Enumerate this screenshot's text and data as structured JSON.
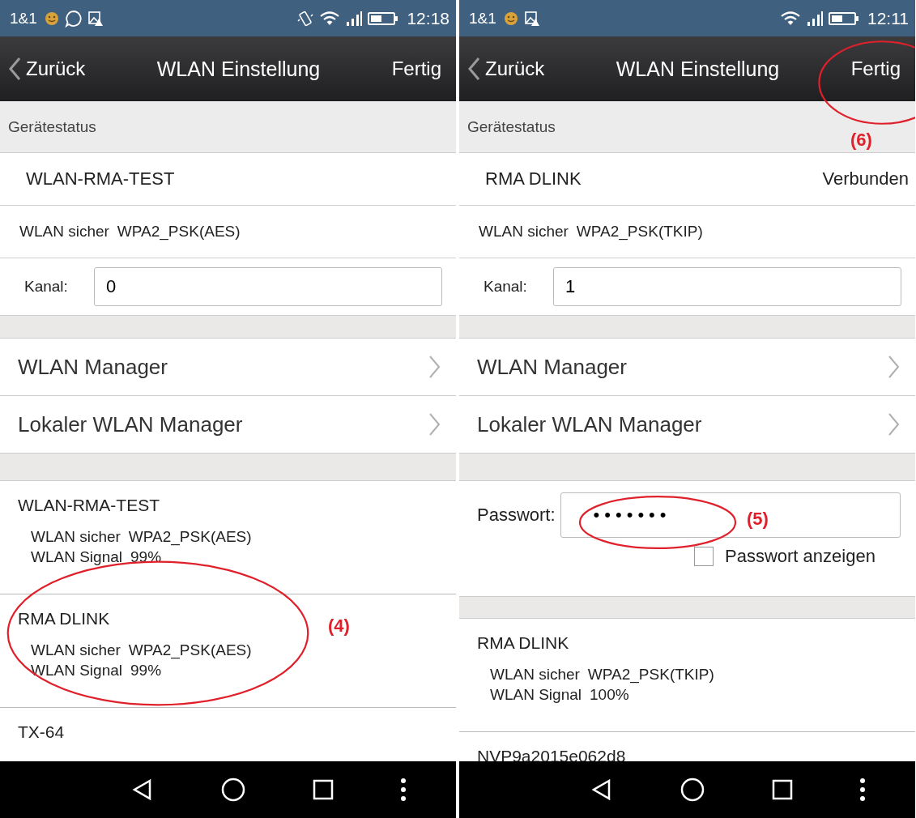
{
  "screens": [
    {
      "status_bar": {
        "carrier": "1&1",
        "time": "12:18",
        "chat_notification": true,
        "vibrate_mode": true
      },
      "nav": {
        "back": "Zurück",
        "title": "WLAN Einstellung",
        "done": "Fertig"
      },
      "device_status": {
        "header": "Gerätestatus",
        "network": "WLAN-RMA-TEST",
        "security_label": "WLAN sicher",
        "security": "WPA2_PSK(AES)",
        "channel_label": "Kanal:",
        "channel": "0"
      },
      "menu": [
        {
          "label": "WLAN Manager"
        },
        {
          "label": "Lokaler WLAN Manager"
        }
      ],
      "networks": [
        {
          "name": "WLAN-RMA-TEST",
          "security_label": "WLAN sicher",
          "security": "WPA2_PSK(AES)",
          "signal_label": "WLAN Signal",
          "signal": "99%"
        },
        {
          "name": "RMA DLINK",
          "security_label": "WLAN sicher",
          "security": "WPA2_PSK(AES)",
          "signal_label": "WLAN Signal",
          "signal": "99%"
        },
        {
          "name": "TX-64"
        }
      ],
      "annotations": [
        {
          "kind": "network",
          "label": "(4)"
        }
      ]
    },
    {
      "status_bar": {
        "carrier": "1&1",
        "time": "12:11",
        "chat_notification": false,
        "vibrate_mode": false
      },
      "nav": {
        "back": "Zurück",
        "title": "WLAN Einstellung",
        "done": "Fertig"
      },
      "device_status": {
        "header": "Gerätestatus",
        "network": "RMA DLINK",
        "state": "Verbunden",
        "security_label": "WLAN sicher",
        "security": "WPA2_PSK(TKIP)",
        "channel_label": "Kanal:",
        "channel": "1"
      },
      "menu": [
        {
          "label": "WLAN Manager"
        },
        {
          "label": "Lokaler WLAN Manager"
        }
      ],
      "password": {
        "label": "Passwort:",
        "value": "•••••••",
        "show_label": "Passwort anzeigen",
        "checked": false
      },
      "networks": [
        {
          "name": "RMA DLINK",
          "security_label": "WLAN sicher",
          "security": "WPA2_PSK(TKIP)",
          "signal_label": "WLAN Signal",
          "signal": "100%"
        },
        {
          "name": "NVP9a2015e062d8"
        }
      ],
      "annotations": [
        {
          "kind": "password",
          "label": "(5)"
        },
        {
          "kind": "done",
          "label": "(6)"
        }
      ]
    }
  ]
}
